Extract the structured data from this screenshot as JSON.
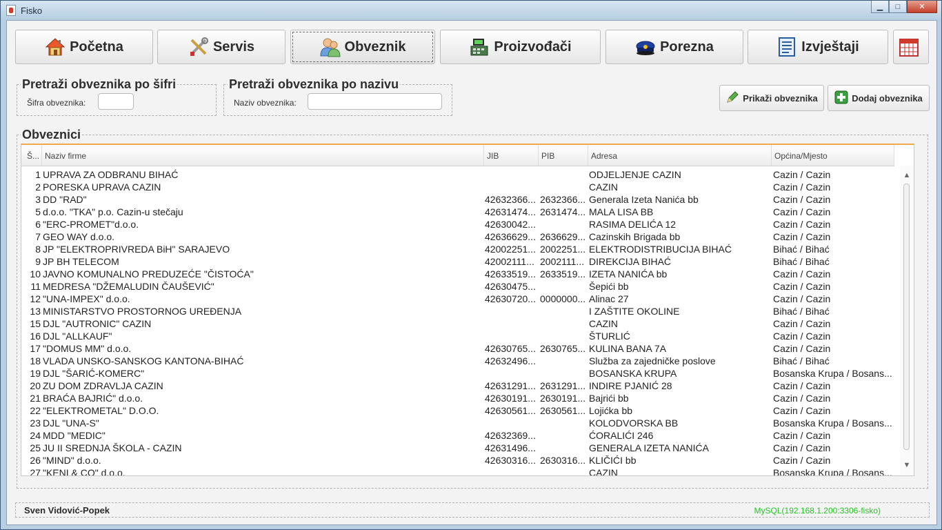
{
  "window": {
    "title": "Fisko",
    "min_glyph": "▁",
    "max_glyph": "□",
    "close_glyph": "✕"
  },
  "nav": [
    {
      "label": "Početna",
      "icon": "house-icon"
    },
    {
      "label": "Servis",
      "icon": "tools-icon"
    },
    {
      "label": "Obveznik",
      "icon": "users-icon",
      "active": true
    },
    {
      "label": "Proizvođači",
      "icon": "cash-register-icon"
    },
    {
      "label": "Porezna",
      "icon": "police-cap-icon"
    },
    {
      "label": "Izvještaji",
      "icon": "report-icon"
    },
    {
      "label": "",
      "icon": "calendar-icon"
    }
  ],
  "search_by_code": {
    "legend": "Pretraži obveznika po šifri",
    "label": "Šifra obveznika:",
    "value": ""
  },
  "search_by_name": {
    "legend": "Pretraži obveznika po nazivu",
    "label": "Naziv obveznika:",
    "value": ""
  },
  "actions": {
    "show_label": "Prikaži obveznika",
    "add_label": "Dodaj obveznika"
  },
  "table": {
    "legend": "Obveznici",
    "columns": [
      "Š...",
      "Naziv firme",
      "JIB",
      "PIB",
      "Adresa",
      "Općina/Mjesto"
    ],
    "rows": [
      [
        "1",
        "UPRAVA ZA ODBRANU BIHAĆ",
        "",
        "",
        "ODJELJENJE CAZIN",
        "Cazin / Cazin"
      ],
      [
        "2",
        "PORESKA UPRAVA CAZIN",
        "",
        "",
        "CAZIN",
        "Cazin / Cazin"
      ],
      [
        "3",
        "DD \"RAD\"",
        "42632366...",
        "2632366...",
        "Generala Izeta Nanića bb",
        "Cazin / Cazin"
      ],
      [
        "5",
        "d.o.o. \"TKA\" p.o. Cazin-u stečaju",
        "42631474...",
        "2631474...",
        "MALA LISA BB",
        "Cazin / Cazin"
      ],
      [
        "6",
        "\"ERC-PROMET\"d.o.o.",
        "42630042...",
        "",
        "RASIMA DELIĆA 12",
        "Cazin / Cazin"
      ],
      [
        "7",
        "GEO WAY d.o.o.",
        "42636629...",
        "2636629...",
        "Cazinskih Brigada bb",
        "Cazin / Cazin"
      ],
      [
        "8",
        "JP \"ELEKTROPRIVREDA BiH\" SARAJEVO",
        "42002251...",
        "2002251...",
        "ELEKTRODISTRIBUCIJA BIHAĆ",
        "Bihać / Bihać"
      ],
      [
        "9",
        "JP BH TELECOM",
        "42002111...",
        "2002111...",
        "DIREKCIJA BIHAĆ",
        "Bihać / Bihać"
      ],
      [
        "10",
        "JAVNO KOMUNALNO PREDUZEĆE \"ČISTOĆA\"",
        "42633519...",
        "2633519...",
        "IZETA NANIĆA bb",
        "Cazin / Cazin"
      ],
      [
        "11",
        "MEDRESA \"DŽEMALUDIN ČAUŠEVIĆ\"",
        "42630475...",
        "",
        "Šepići bb",
        "Cazin / Cazin"
      ],
      [
        "12",
        "\"UNA-IMPEX\" d.o.o.",
        "42630720...",
        "0000000...",
        "Alinac 27",
        "Cazin / Cazin"
      ],
      [
        "13",
        "MINISTARSTVO PROSTORNOG UREĐENJA",
        "",
        "",
        "I ZAŠTITE OKOLINE",
        "Bihać / Bihać"
      ],
      [
        "15",
        "DJL \"AUTRONIC\" CAZIN",
        "",
        "",
        "CAZIN",
        "Cazin / Cazin"
      ],
      [
        "16",
        "DJL \"ALLKAUF\"",
        "",
        "",
        "ŠTURLIĆ",
        "Cazin / Cazin"
      ],
      [
        "17",
        "\"DOMUS MM\" d.o.o.",
        "42630765...",
        "2630765...",
        "KULINA BANA 7A",
        "Cazin / Cazin"
      ],
      [
        "18",
        "VLADA UNSKO-SANSKOG KANTONA-BIHAĆ",
        "42632496...",
        "",
        "Služba za zajedničke poslove",
        "Bihać / Bihać"
      ],
      [
        "19",
        "DJL \"ŠARIĆ-KOMERC\"",
        "",
        "",
        "BOSANSKA KRUPA",
        "Bosanska Krupa / Bosans..."
      ],
      [
        "20",
        "ZU DOM ZDRAVLJA CAZIN",
        "42631291...",
        "2631291...",
        "INDIRE PJANIĆ 28",
        "Cazin / Cazin"
      ],
      [
        "21",
        "BRAĆA BAJRIĆ\" d.o.o.",
        "42630191...",
        "2630191...",
        "Bajrići bb",
        "Cazin / Cazin"
      ],
      [
        "22",
        "\"ELEKTROMETAL\" D.O.O.",
        "42630561...",
        "2630561...",
        "Lojićka bb",
        "Cazin / Cazin"
      ],
      [
        "23",
        "DJL \"UNA-S\"",
        "",
        "",
        "KOLODVORSKA BB",
        "Bosanska Krupa / Bosans..."
      ],
      [
        "24",
        "MDD \"MEDIC\"",
        "42632369...",
        "",
        "ĆORALIĆI 246",
        "Cazin / Cazin"
      ],
      [
        "25",
        "JU II SREDNJA ŠKOLA - CAZIN",
        "42631496...",
        "",
        "GENERALA IZETA NANIĆA",
        "Cazin / Cazin"
      ],
      [
        "26",
        "\"MIND\" d.o.o.",
        "42630316...",
        "2630316...",
        "KLIČIĆI bb",
        "Cazin / Cazin"
      ],
      [
        "27",
        "\"KENI & CO\" d.o.o.",
        "",
        "",
        "CAZIN",
        "Bosanska Krupa / Bosans..."
      ]
    ]
  },
  "status": {
    "user": "Sven Vidović-Popek",
    "db": "MySQL(192.168.1.200:3306-fisko)"
  },
  "colors": {
    "accent": "#f0a84c",
    "db_status": "#22c422"
  }
}
